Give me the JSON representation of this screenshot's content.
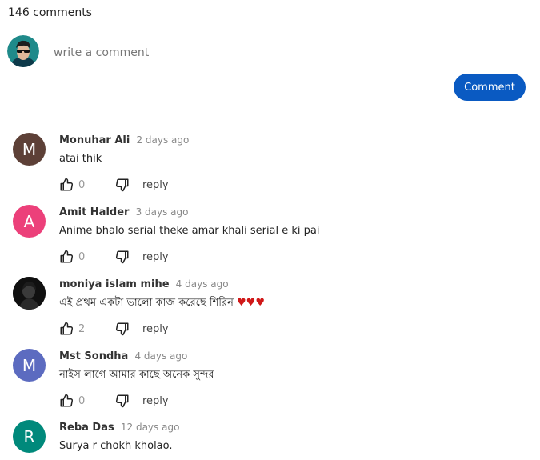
{
  "comments_count": "146 comments",
  "composer": {
    "placeholder": "write a comment",
    "submit_label": "Comment"
  },
  "reply_label": "reply",
  "comments": [
    {
      "author": "Monuhar Ali",
      "time": "2 days ago",
      "text": "atai thik",
      "likes": "0",
      "avatar_letter": "M",
      "avatar_color": "#5d4037"
    },
    {
      "author": "Amit Halder",
      "time": "3 days ago",
      "text": "Anime bhalo serial theke amar khali serial e ki pai",
      "likes": "0",
      "avatar_letter": "A",
      "avatar_color": "#ec407a"
    },
    {
      "author": "moniya islam mihe",
      "time": "4 days ago",
      "text": "এই প্রথম একটা ভালো কাজ করেছে শিরিন",
      "hearts": "♥♥♥",
      "likes": "2",
      "avatar_letter": "",
      "avatar_color": "#1a1a1a"
    },
    {
      "author": "Mst Sondha",
      "time": "4 days ago",
      "text": "নাইস লাগে আমার কাছে অনেক সুন্দর",
      "likes": "0",
      "avatar_letter": "M",
      "avatar_color": "#5c6bc0"
    },
    {
      "author": "Reba Das",
      "time": "12 days ago",
      "text": "Surya r chokh kholao.",
      "likes": "",
      "avatar_letter": "R",
      "avatar_color": "#00897b"
    }
  ]
}
